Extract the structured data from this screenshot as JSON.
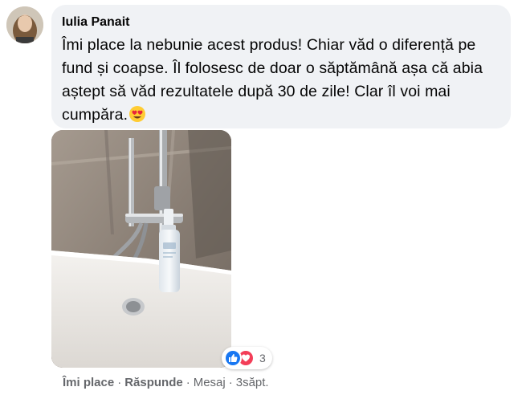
{
  "comment": {
    "author": "Iulia Panait",
    "text": "Îmi place la nebunie acest produs! Chiar văd o diferență pe fund și coapse. Îl folosesc de doar o săptămână așa că abia aștept să văd rezultatele după 30 de zile! Clar îl voi mai cumpăra.",
    "emoji": "heart-eyes-emoji"
  },
  "reactions": {
    "icons": [
      "like-icon",
      "love-icon"
    ],
    "count": "3",
    "colors": {
      "like": "#1877f2",
      "love": "#f33e58"
    }
  },
  "actions": {
    "like_label": "Îmi place",
    "reply_label": "Răspunde",
    "message_label": "Mesaj",
    "separator": "·",
    "time": "3săpt."
  },
  "theme": {
    "bubble_bg": "#f0f2f5",
    "text_color": "#050505",
    "meta_color": "#65676b"
  }
}
